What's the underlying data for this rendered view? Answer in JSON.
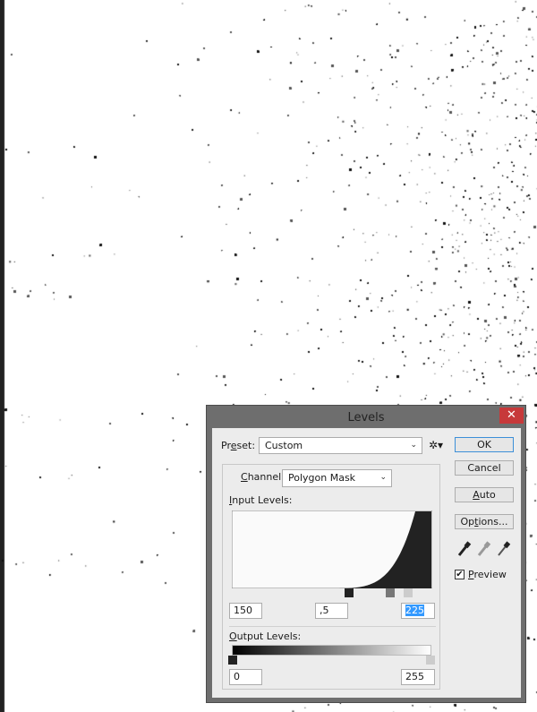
{
  "dialog": {
    "title": "Levels",
    "close_icon": "close-icon",
    "preset": {
      "label_pre": "Pr",
      "label_u": "e",
      "label_post": "set:",
      "value": "Custom"
    },
    "channel": {
      "label_u": "C",
      "label_post": "hannel:",
      "value": "Polygon Mask"
    },
    "input_levels": {
      "label_u": "I",
      "label_post": "nput Levels:",
      "black": "150",
      "gamma": ",5",
      "white": "225"
    },
    "output_levels": {
      "label_u": "O",
      "label_post": "utput Levels:",
      "black": "0",
      "white": "255"
    },
    "buttons": {
      "ok": "OK",
      "cancel": "Cancel",
      "auto_u": "A",
      "auto_post": "uto",
      "options_pre": "Op",
      "options_u": "t",
      "options_post": "ions..."
    },
    "preview": {
      "label_u": "P",
      "label_post": "review",
      "checked": true
    },
    "colors": {
      "titlebar": "#6e6e6e",
      "close": "#c7393a",
      "selection": "#3399ff",
      "histogram": "#222222"
    }
  }
}
